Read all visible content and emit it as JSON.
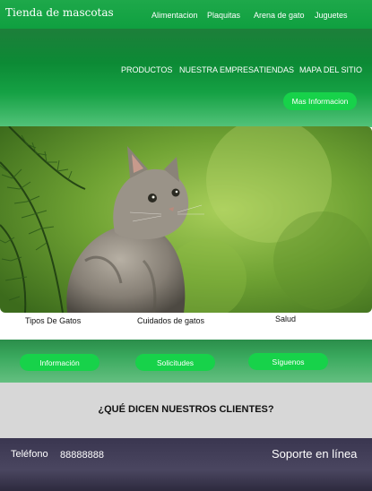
{
  "brand": {
    "name": "Tienda de mascotas"
  },
  "top_nav": [
    "Alimentacion",
    "Plaquitas",
    "Arena de gato",
    "Juguetes"
  ],
  "main_nav": [
    "PRODUCTOS",
    "NUESTRA EMPRESA",
    "TIENDAS",
    "MAPA DEL SITIO"
  ],
  "hero": {
    "button_label": "Mas Informacion"
  },
  "captions": [
    "Tipos De Gatos",
    "Cuidados de gatos",
    "Salud"
  ],
  "actions": [
    "Información",
    "Solicitudes",
    "Síguenos"
  ],
  "testimonials": {
    "title": "¿QUÉ DICEN NUESTROS CLIENTES?"
  },
  "footer": {
    "phone_label": "Teléfono",
    "phone_number": "88888888",
    "support": "Soporte en línea"
  },
  "colors": {
    "brand_green": "#0fa040",
    "button_green": "#17d24a",
    "testimonials_gray": "#d7d7d7",
    "footer_dark": "#3a3650"
  }
}
